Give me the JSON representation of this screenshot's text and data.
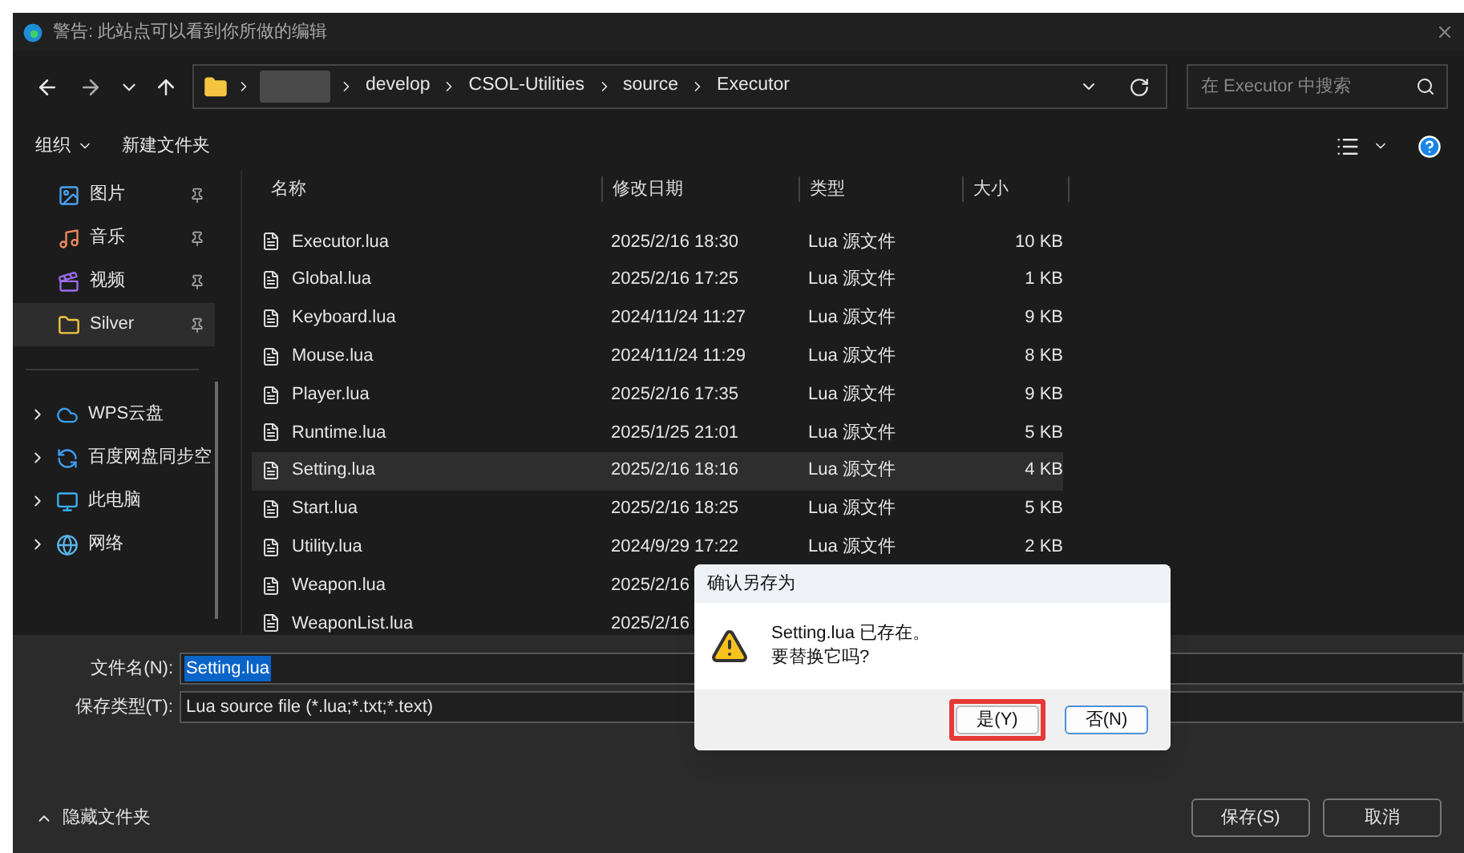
{
  "window": {
    "title": "警告: 此站点可以看到你所做的编辑"
  },
  "address_bar": {
    "crumbs": [
      "develop",
      "CSOL-Utilities",
      "source",
      "Executor"
    ]
  },
  "search": {
    "placeholder": "在 Executor 中搜索"
  },
  "toolbar": {
    "organize": "组织",
    "new_folder": "新建文件夹"
  },
  "sidebar": {
    "quick_access": [
      {
        "label": "图片",
        "kind": "pictures",
        "selected": false
      },
      {
        "label": "音乐",
        "kind": "music",
        "selected": false
      },
      {
        "label": "视频",
        "kind": "videos",
        "selected": false
      },
      {
        "label": "Silver",
        "kind": "folder",
        "selected": true
      }
    ],
    "tree": [
      {
        "label": "WPS云盘",
        "kind": "cloud",
        "expanded": false
      },
      {
        "label": "百度网盘同步空",
        "kind": "sync",
        "expanded": false
      },
      {
        "label": "此电脑",
        "kind": "computer",
        "expanded": false
      },
      {
        "label": "网络",
        "kind": "network",
        "expanded": false
      }
    ]
  },
  "table": {
    "columns": [
      "名称",
      "修改日期",
      "类型",
      "大小"
    ],
    "rows": [
      {
        "name": "Executor.lua",
        "date": "2025/2/16 18:30",
        "type": "Lua 源文件",
        "size": "10 KB",
        "selected": false
      },
      {
        "name": "Global.lua",
        "date": "2025/2/16 17:25",
        "type": "Lua 源文件",
        "size": "1 KB",
        "selected": false
      },
      {
        "name": "Keyboard.lua",
        "date": "2024/11/24 11:27",
        "type": "Lua 源文件",
        "size": "9 KB",
        "selected": false
      },
      {
        "name": "Mouse.lua",
        "date": "2024/11/24 11:29",
        "type": "Lua 源文件",
        "size": "8 KB",
        "selected": false
      },
      {
        "name": "Player.lua",
        "date": "2025/2/16 17:35",
        "type": "Lua 源文件",
        "size": "9 KB",
        "selected": false
      },
      {
        "name": "Runtime.lua",
        "date": "2025/1/25 21:01",
        "type": "Lua 源文件",
        "size": "5 KB",
        "selected": false
      },
      {
        "name": "Setting.lua",
        "date": "2025/2/16 18:16",
        "type": "Lua 源文件",
        "size": "4 KB",
        "selected": true
      },
      {
        "name": "Start.lua",
        "date": "2025/2/16 18:25",
        "type": "Lua 源文件",
        "size": "5 KB",
        "selected": false
      },
      {
        "name": "Utility.lua",
        "date": "2024/9/29 17:22",
        "type": "Lua 源文件",
        "size": "2 KB",
        "selected": false
      },
      {
        "name": "Weapon.lua",
        "date": "2025/2/16",
        "selected": false
      },
      {
        "name": "WeaponList.lua",
        "date": "2025/2/16",
        "selected": false
      }
    ]
  },
  "form": {
    "file_name_label": "文件名(N):",
    "file_name": "Setting.lua",
    "save_type_label": "保存类型(T):",
    "save_type": "Lua source file (*.lua;*.txt;*.text)"
  },
  "footer": {
    "hide_folders": "隐藏文件夹",
    "save": "保存(S)",
    "cancel": "取消"
  },
  "dialog": {
    "title": "确认另存为",
    "message": "Setting.lua 已存在。",
    "question": "要替换它吗?",
    "buttons": [
      {
        "label": "是(Y)",
        "highlighted": true
      },
      {
        "label": "否(N)",
        "highlighted": false
      }
    ]
  }
}
